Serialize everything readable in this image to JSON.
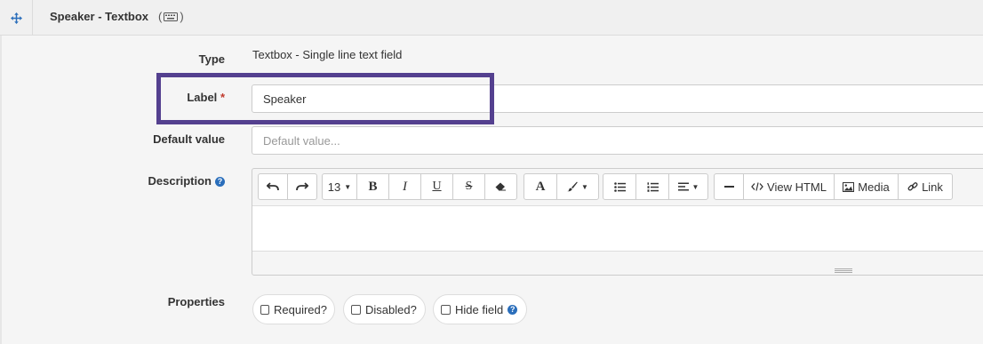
{
  "header": {
    "title": "Speaker - Textbox",
    "paren_open": "(",
    "paren_close": ")"
  },
  "icons": {
    "drag": "move-arrows-icon",
    "type": "keyboard-icon",
    "help": "question-circle-icon"
  },
  "fields": {
    "type": {
      "label": "Type",
      "value": "Textbox - Single line text field"
    },
    "label": {
      "label": "Label",
      "required_mark": "*",
      "value": "Speaker"
    },
    "default_value": {
      "label": "Default value",
      "placeholder": "Default value..."
    },
    "description": {
      "label": "Description",
      "help": "?"
    }
  },
  "editor_toolbar": {
    "font_size": "13",
    "bold": "B",
    "italic": "I",
    "underline": "U",
    "strike": "S",
    "font_color": "A",
    "view_html": "View HTML",
    "media": "Media",
    "link": "Link"
  },
  "properties": {
    "label": "Properties",
    "required": "Required?",
    "disabled": "Disabled?",
    "hide_field": "Hide field",
    "help": "?"
  },
  "colors": {
    "highlight": "#54408f",
    "accent": "#2a6ebb",
    "required": "#c0392b"
  }
}
